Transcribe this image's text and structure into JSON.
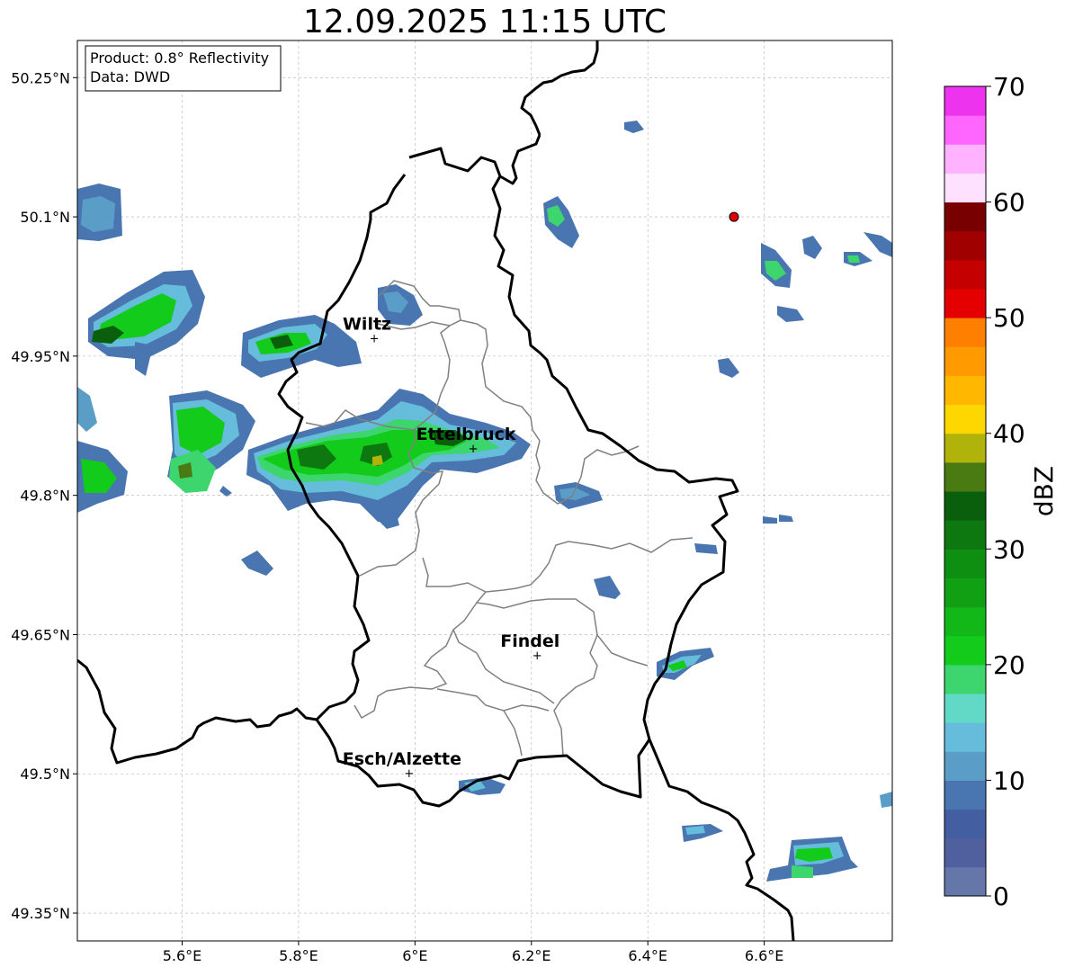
{
  "title": "12.09.2025 11:15 UTC",
  "info": {
    "product": "Product: 0.8° Reflectivity",
    "data": "Data: DWD"
  },
  "map": {
    "lon_range": [
      5.42,
      6.82
    ],
    "lat_range": [
      49.32,
      50.29
    ],
    "lon_ticks": [
      {
        "value": 5.6,
        "label": "5.6°E"
      },
      {
        "value": 5.8,
        "label": "5.8°E"
      },
      {
        "value": 6.0,
        "label": "6°E"
      },
      {
        "value": 6.2,
        "label": "6.2°E"
      },
      {
        "value": 6.4,
        "label": "6.4°E"
      },
      {
        "value": 6.6,
        "label": "6.6°E"
      }
    ],
    "lat_ticks": [
      {
        "value": 50.25,
        "label": "50.25°N"
      },
      {
        "value": 50.1,
        "label": "50.1°N"
      },
      {
        "value": 49.95,
        "label": "49.95°N"
      },
      {
        "value": 49.8,
        "label": "49.8°N"
      },
      {
        "value": 49.65,
        "label": "49.65°N"
      },
      {
        "value": 49.5,
        "label": "49.5°N"
      },
      {
        "value": 49.35,
        "label": "49.35°N"
      }
    ],
    "grid": true,
    "cities": [
      {
        "name": "Wiltz",
        "lon": 5.93,
        "lat": 49.969
      },
      {
        "name": "Ettelbruck",
        "lon": 6.1,
        "lat": 49.85
      },
      {
        "name": "Findel",
        "lon": 6.21,
        "lat": 49.627
      },
      {
        "name": "Esch/Alzette",
        "lon": 5.99,
        "lat": 49.5
      }
    ],
    "radar_site": {
      "lon": 6.548,
      "lat": 50.1,
      "color": "#e00000"
    }
  },
  "colorbar": {
    "label": "dBZ",
    "min": 0,
    "max": 70,
    "step": 2.5,
    "ticks": [
      {
        "value": 0,
        "label": "0"
      },
      {
        "value": 10,
        "label": "10"
      },
      {
        "value": 20,
        "label": "20"
      },
      {
        "value": 30,
        "label": "30"
      },
      {
        "value": 40,
        "label": "40"
      },
      {
        "value": 50,
        "label": "50"
      },
      {
        "value": 60,
        "label": "60"
      },
      {
        "value": 70,
        "label": "70"
      }
    ],
    "colors": [
      "#6577a8",
      "#50609e",
      "#445ea2",
      "#4976b0",
      "#5a9ec8",
      "#66bddb",
      "#62d8c6",
      "#3dd56e",
      "#12cb1b",
      "#11b818",
      "#119f14",
      "#0f8f12",
      "#0d7810",
      "#0a5f0c",
      "#4a7a12",
      "#b0b30a",
      "#ffd700",
      "#ffb700",
      "#ff9a00",
      "#ff7f00",
      "#e50000",
      "#c50000",
      "#a00000",
      "#780000",
      "#ffe0ff",
      "#ffb2ff",
      "#ff66ff",
      "#ee33ee"
    ]
  }
}
